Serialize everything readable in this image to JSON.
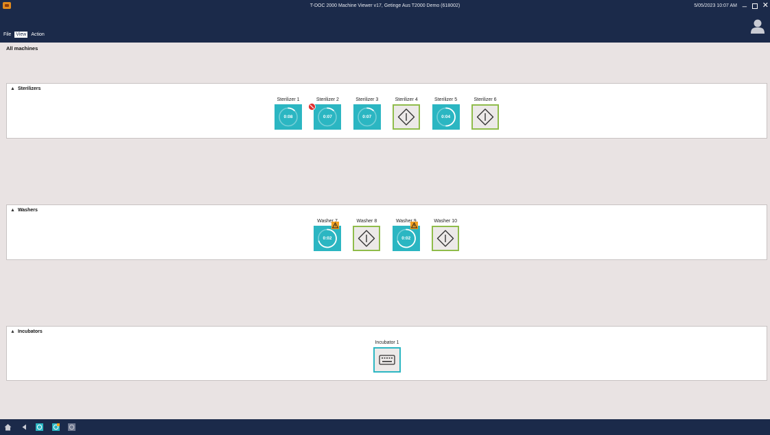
{
  "window": {
    "title": "T-DOC 2000 Machine Viewer v17, Getinge Aus T2000 Demo (618002)",
    "clock": "5/05/2023 10:07 AM"
  },
  "menu": [
    {
      "label": "File",
      "active": false
    },
    {
      "label": "View",
      "active": true
    },
    {
      "label": "Action",
      "active": false
    }
  ],
  "page": {
    "heading": "All machines"
  },
  "groups": {
    "sterilizers": {
      "label": "Sterilizers",
      "machines": [
        {
          "name": "Sterilizer 1",
          "state": "running",
          "time": "0:08",
          "progress": 0.12
        },
        {
          "name": "Sterilizer 2",
          "state": "running",
          "time": "0:07",
          "progress": 0.12,
          "badge": "error"
        },
        {
          "name": "Sterilizer 3",
          "state": "running",
          "time": "0:07",
          "progress": 0.12
        },
        {
          "name": "Sterilizer 4",
          "state": "idle"
        },
        {
          "name": "Sterilizer 5",
          "state": "running",
          "time": "0:04",
          "progress": 0.5
        },
        {
          "name": "Sterilizer 6",
          "state": "idle"
        }
      ]
    },
    "washers": {
      "label": "Washers",
      "machines": [
        {
          "name": "Washer 7",
          "state": "running",
          "time": "0:02",
          "progress": 0.7,
          "badge": "warning"
        },
        {
          "name": "Washer 8",
          "state": "idle"
        },
        {
          "name": "Washer 9",
          "state": "running",
          "time": "0:02",
          "progress": 0.7,
          "badge": "warning"
        },
        {
          "name": "Washer 10",
          "state": "idle"
        }
      ]
    },
    "incubators": {
      "label": "Incubators",
      "machines": [
        {
          "name": "Incubator 1",
          "state": "incubator"
        }
      ]
    }
  },
  "icons": {
    "collapse": "triangle-up-icon",
    "idle": "start-diamond-icon",
    "incubator": "keyboard-icon",
    "error": "error-icon",
    "warning": "warning-icon"
  },
  "colors": {
    "titlebar": "#1b2a4a",
    "running": "#2bb6c2",
    "idle_border": "#8fbc4a",
    "warning": "#f0a020",
    "error": "#e03030"
  }
}
